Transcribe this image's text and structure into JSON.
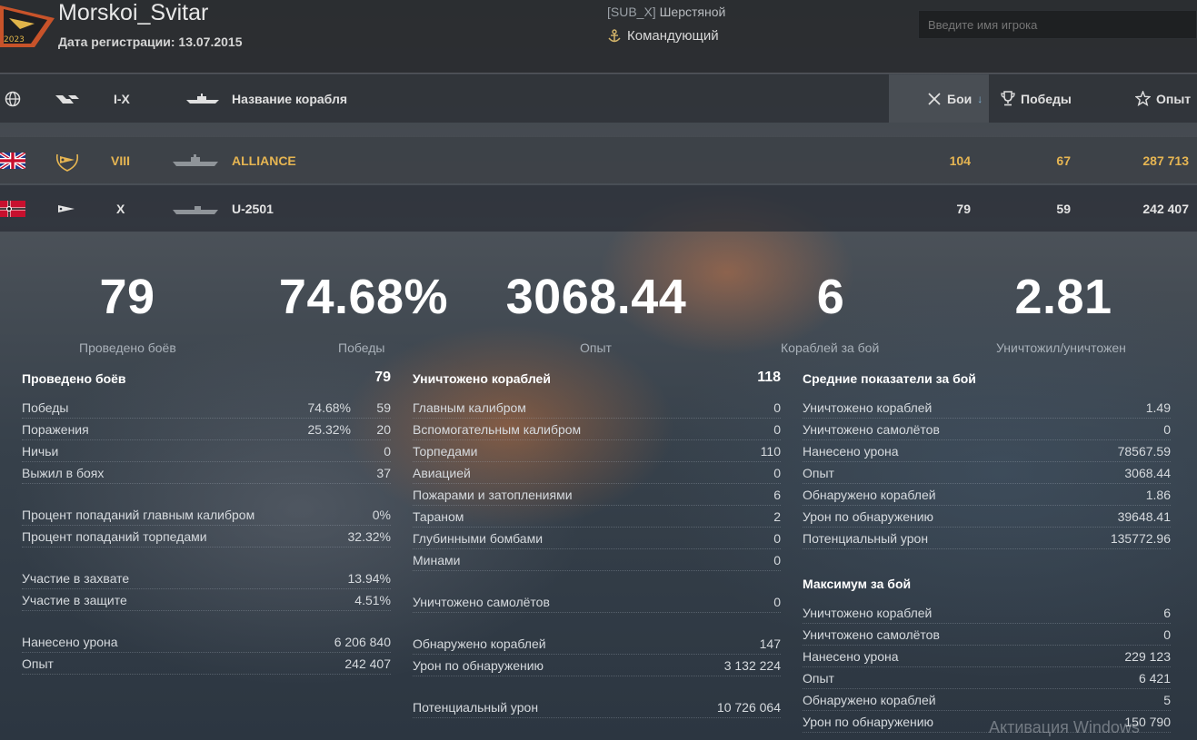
{
  "header": {
    "player_name": "Morskoi_Svitar",
    "reg_date": "Дата регистрации: 13.07.2015",
    "clan_tag": "[SUB_X]",
    "clan_name": "Шерстяной",
    "rank": "Командующий",
    "search_placeholder": "Введите имя игрока",
    "logo_text": "2023"
  },
  "table_header": {
    "tier_range": "I-X",
    "ship_name": "Название корабля",
    "battles": "Бои",
    "wins": "Победы",
    "exp": "Опыт"
  },
  "ships": [
    {
      "nation": "uk-flag",
      "type": "submarine-premium-icon",
      "tier": "VIII",
      "name": "ALLIANCE",
      "battles": "104",
      "wins": "67",
      "exp": "287 713",
      "color": "#e6b552"
    },
    {
      "nation": "germany-flag",
      "type": "submarine-icon",
      "tier": "X",
      "name": "U-2501",
      "battles": "79",
      "wins": "59",
      "exp": "242 407",
      "color": "#e4e4e4"
    }
  ],
  "summary": [
    {
      "value": "79",
      "label": "Проведено боёв"
    },
    {
      "value": "74.68%",
      "label": "Победы"
    },
    {
      "value": "3068.44",
      "label": "Опыт"
    },
    {
      "value": "6",
      "label": "Кораблей за бой"
    },
    {
      "value": "2.81",
      "label": "Уничтожил/уничтожен"
    }
  ],
  "col1": {
    "title": "Проведено боёв",
    "title_value": "79",
    "rows": [
      {
        "label": "Победы",
        "pct": "74.68%",
        "value": "59"
      },
      {
        "label": "Поражения",
        "pct": "25.32%",
        "value": "20"
      },
      {
        "label": "Ничьи",
        "value": "0"
      },
      {
        "label": "Выжил в боях",
        "value": "37"
      },
      {
        "label": "Процент попаданий главным калибром",
        "value": "0%"
      },
      {
        "label": "Процент попаданий торпедами",
        "value": "32.32%"
      },
      {
        "label": "Участие в захвате",
        "value": "13.94%"
      },
      {
        "label": "Участие в защите",
        "value": "4.51%"
      },
      {
        "label": "Нанесено урона",
        "value": "6 206 840"
      },
      {
        "label": "Опыт",
        "value": "242 407"
      }
    ]
  },
  "col2": {
    "title": "Уничтожено кораблей",
    "title_value": "118",
    "rows": [
      {
        "label": "Главным калибром",
        "value": "0"
      },
      {
        "label": "Вспомогательным калибром",
        "value": "0"
      },
      {
        "label": "Торпедами",
        "value": "110"
      },
      {
        "label": "Авиацией",
        "value": "0"
      },
      {
        "label": "Пожарами и затоплениями",
        "value": "6"
      },
      {
        "label": "Тараном",
        "value": "2"
      },
      {
        "label": "Глубинными бомбами",
        "value": "0"
      },
      {
        "label": "Минами",
        "value": "0"
      },
      {
        "label": "Уничтожено самолётов",
        "value": "0"
      },
      {
        "label": "Обнаружено кораблей",
        "value": "147"
      },
      {
        "label": "Урон по обнаружению",
        "value": "3 132 224"
      },
      {
        "label": "Потенциальный урон",
        "value": "10 726 064"
      }
    ]
  },
  "col3": {
    "title": "Средние показатели за бой",
    "rows": [
      {
        "label": "Уничтожено кораблей",
        "value": "1.49"
      },
      {
        "label": "Уничтожено самолётов",
        "value": "0"
      },
      {
        "label": "Нанесено урона",
        "value": "78567.59"
      },
      {
        "label": "Опыт",
        "value": "3068.44"
      },
      {
        "label": "Обнаружено кораблей",
        "value": "1.86"
      },
      {
        "label": "Урон по обнаружению",
        "value": "39648.41"
      },
      {
        "label": "Потенциальный урон",
        "value": "135772.96"
      }
    ],
    "title2": "Максимум за бой",
    "rows2": [
      {
        "label": "Уничтожено кораблей",
        "value": "6"
      },
      {
        "label": "Уничтожено самолётов",
        "value": "0"
      },
      {
        "label": "Нанесено урона",
        "value": "229 123"
      },
      {
        "label": "Опыт",
        "value": "6 421"
      },
      {
        "label": "Обнаружено кораблей",
        "value": "5"
      },
      {
        "label": "Урон по обнаружению",
        "value": "150 790"
      }
    ]
  },
  "watermark": "Активация Windows",
  "colors": {
    "accent_gold": "#e6b552",
    "topbar_bg": "#2a2c30",
    "text": "#d9dde2"
  }
}
